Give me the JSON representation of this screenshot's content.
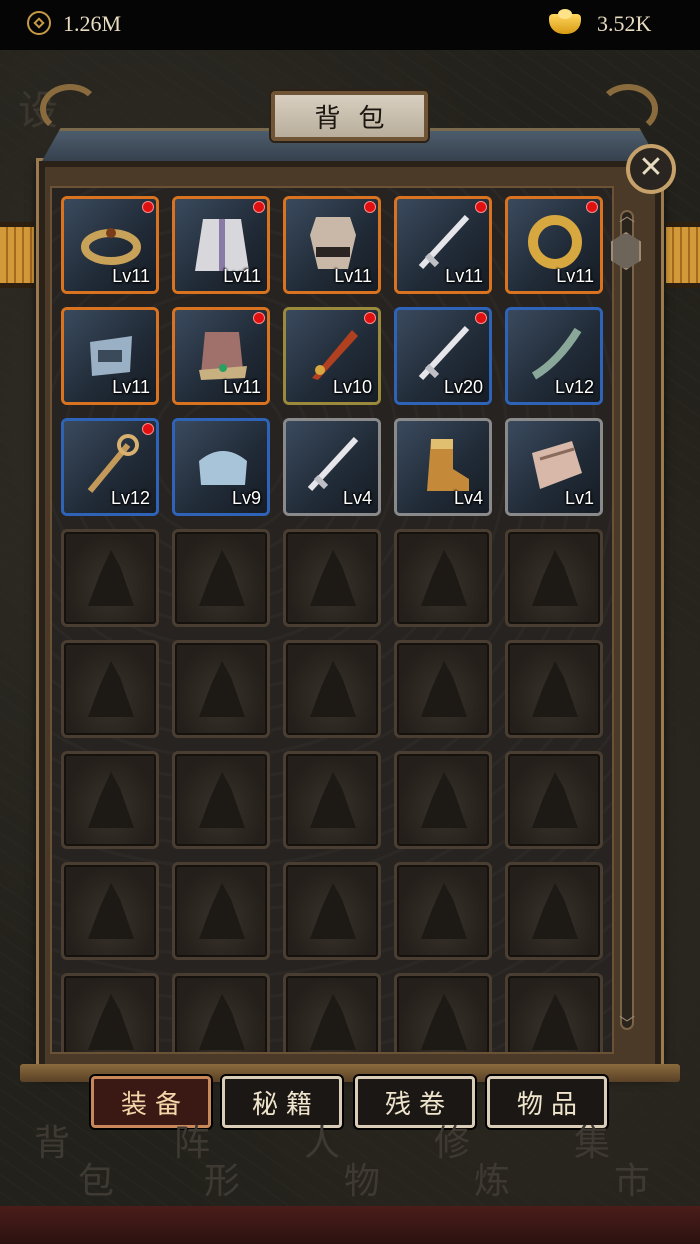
{
  "topbar": {
    "coin_icon": "coin-icon",
    "coins": "1.26M",
    "ingot_icon": "gold-ingot-icon",
    "ingots": "3.52K"
  },
  "panel": {
    "title": "背包",
    "close_icon": "close-icon",
    "close_glyph": "✕"
  },
  "items": [
    {
      "level": "Lv11",
      "type": "bracer",
      "rarity": "orange",
      "new": true
    },
    {
      "level": "Lv11",
      "type": "robe",
      "rarity": "orange",
      "new": true
    },
    {
      "level": "Lv11",
      "type": "armor",
      "rarity": "orange",
      "new": true
    },
    {
      "level": "Lv11",
      "type": "sword",
      "rarity": "orange",
      "new": true
    },
    {
      "level": "Lv11",
      "type": "ring",
      "rarity": "orange",
      "new": true
    },
    {
      "level": "Lv11",
      "type": "helmet",
      "rarity": "orange",
      "new": false
    },
    {
      "level": "Lv11",
      "type": "hat",
      "rarity": "orange",
      "new": true
    },
    {
      "level": "Lv10",
      "type": "blade",
      "rarity": "gold",
      "new": true
    },
    {
      "level": "Lv20",
      "type": "sword",
      "rarity": "blue",
      "new": true
    },
    {
      "level": "Lv12",
      "type": "dagger",
      "rarity": "blue",
      "new": false
    },
    {
      "level": "Lv12",
      "type": "staff",
      "rarity": "blue",
      "new": true
    },
    {
      "level": "Lv9",
      "type": "cloth-hat",
      "rarity": "blue",
      "new": false
    },
    {
      "level": "Lv4",
      "type": "sword",
      "rarity": "gray",
      "new": false
    },
    {
      "level": "Lv4",
      "type": "boots",
      "rarity": "gray",
      "new": false
    },
    {
      "level": "Lv1",
      "type": "gloves",
      "rarity": "gray",
      "new": false
    }
  ],
  "empty_slot_count": 25,
  "tabs": [
    {
      "label": "装备",
      "active": true
    },
    {
      "label": "秘籍",
      "active": false
    },
    {
      "label": "残卷",
      "active": false
    },
    {
      "label": "物品",
      "active": false
    }
  ],
  "nav": [
    {
      "label_top": "背",
      "label_bottom": "包"
    },
    {
      "label_top": "阵",
      "label_bottom": "形"
    },
    {
      "label_top": "人",
      "label_bottom": "物"
    },
    {
      "label_top": "修",
      "label_bottom": "炼"
    },
    {
      "label_top": "集",
      "label_bottom": "市"
    }
  ],
  "side_text": "设",
  "colors": {
    "orange": "#d9731f",
    "blue": "#2f63b8",
    "gold": "#9b8a3c",
    "gray": "#8a8a8a",
    "new_dot": "#e01010"
  }
}
